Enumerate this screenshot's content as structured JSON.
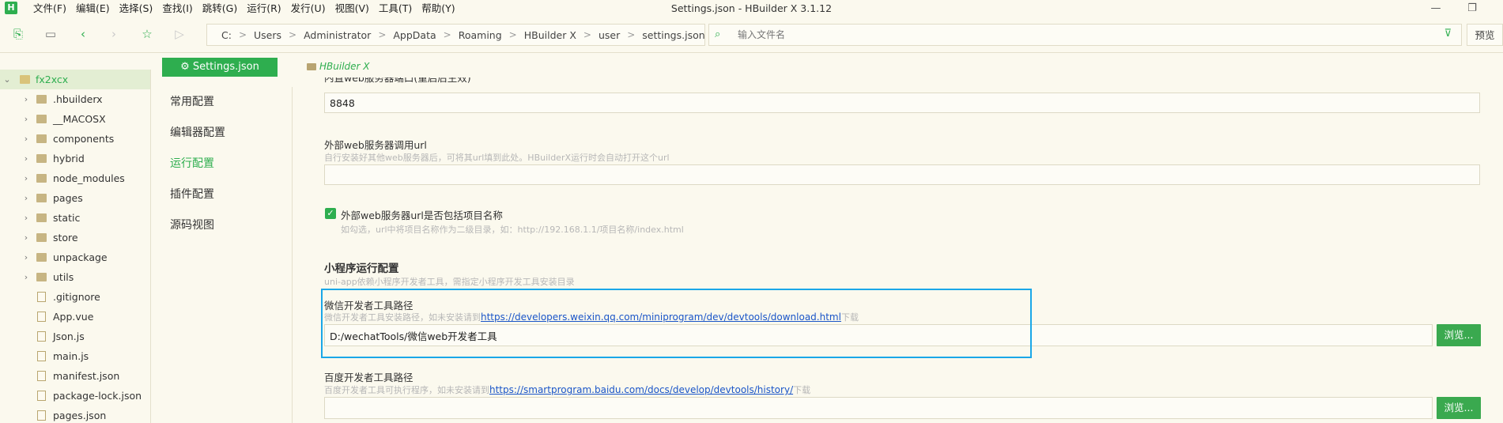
{
  "window": {
    "title": "Settings.json - HBuilder X 3.1.12",
    "menus": [
      "文件(F)",
      "编辑(E)",
      "选择(S)",
      "查找(I)",
      "跳转(G)",
      "运行(R)",
      "发行(U)",
      "视图(V)",
      "工具(T)",
      "帮助(Y)"
    ],
    "app_logo": "H"
  },
  "toolbar": {
    "breadcrumb": [
      "C:",
      "Users",
      "Administrator",
      "AppData",
      "Roaming",
      "HBuilder X",
      "user",
      "settings.json"
    ],
    "file_search_placeholder": "输入文件名",
    "preview_label": "预览"
  },
  "project_tree": {
    "project": "fx2xcx",
    "items": [
      {
        "label": ".hbuilderx",
        "type": "folder"
      },
      {
        "label": "__MACOSX",
        "type": "folder"
      },
      {
        "label": "components",
        "type": "folder"
      },
      {
        "label": "hybrid",
        "type": "folder"
      },
      {
        "label": "node_modules",
        "type": "folder"
      },
      {
        "label": "pages",
        "type": "folder"
      },
      {
        "label": "static",
        "type": "folder"
      },
      {
        "label": "store",
        "type": "folder"
      },
      {
        "label": "unpackage",
        "type": "folder"
      },
      {
        "label": "utils",
        "type": "folder"
      },
      {
        "label": ".gitignore",
        "type": "file"
      },
      {
        "label": "App.vue",
        "type": "file"
      },
      {
        "label": "Json.js",
        "type": "file"
      },
      {
        "label": "main.js",
        "type": "file"
      },
      {
        "label": "manifest.json",
        "type": "file"
      },
      {
        "label": "package-lock.json",
        "type": "file"
      },
      {
        "label": "pages.json",
        "type": "file"
      }
    ]
  },
  "editor": {
    "tab_label": "Settings.json",
    "path_hint": "HBuilder X"
  },
  "settings_nav": {
    "items": [
      "常用配置",
      "编辑器配置",
      "运行配置",
      "插件配置",
      "源码视图"
    ],
    "active": "运行配置"
  },
  "settings": {
    "port_label_partial": "内置web服务器端口(重启后生效)",
    "port_value": "8848",
    "external_url_label": "外部web服务器调用url",
    "external_url_desc": "自行安装好其他web服务器后，可将其url填到此处。HBuilderX运行时会自动打开这个url",
    "external_url_value": "",
    "include_project_label": "外部web服务器url是否包括项目名称",
    "include_project_desc": "如勾选，url中将项目名称作为二级目录，如：http://192.168.1.1/项目名称/index.html",
    "include_project_checked": true,
    "mp_section_title": "小程序运行配置",
    "mp_section_desc": "uni-app依赖小程序开发者工具，需指定小程序开发工具安装目录",
    "wechat_label": "微信开发者工具路径",
    "wechat_desc_prefix": "微信开发者工具安装路径，如未安装请到",
    "wechat_link": "https://developers.weixin.qq.com/miniprogram/dev/devtools/download.html",
    "wechat_desc_suffix": "下载",
    "wechat_value": "D:/wechatTools/微信web开发者工具",
    "baidu_label": "百度开发者工具路径",
    "baidu_desc_prefix": "百度开发者工具可执行程序，如未安装请到",
    "baidu_link": "https://smartprogram.baidu.com/docs/develop/devtools/history/",
    "baidu_desc_suffix": "下载",
    "baidu_value": "",
    "browse_label": "浏览..."
  },
  "colors": {
    "accent_green": "#2eae4f",
    "highlight_blue": "#1aa7e8",
    "background": "#fbf9ee",
    "link": "#1a55c8"
  },
  "icons": [
    "new-file-icon",
    "save-icon",
    "back-icon",
    "forward-icon",
    "star-icon",
    "run-icon",
    "folder-icon",
    "file-search-icon",
    "filter-icon",
    "gear-icon",
    "checkbox-checked-icon",
    "minimize-icon",
    "restore-icon"
  ]
}
